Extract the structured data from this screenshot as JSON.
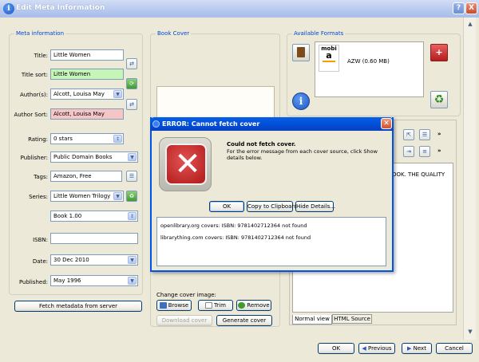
{
  "window": {
    "title": "Edit Meta Information",
    "help_label": "?",
    "close_label": "X"
  },
  "meta": {
    "legend": "Meta information",
    "title_label": "Title:",
    "title_value": "Little Women",
    "title_sort_label": "Title sort:",
    "title_sort_value": "Little Women",
    "authors_label": "Author(s):",
    "authors_value": "Alcott, Louisa May",
    "author_sort_label": "Author Sort:",
    "author_sort_value": "Alcott, Louisa May",
    "rating_label": "Rating:",
    "rating_value": "0 stars",
    "publisher_label": "Publisher:",
    "publisher_value": "Public Domain Books",
    "tags_label": "Tags:",
    "tags_value": "Amazon, Free",
    "series_label": "Series:",
    "series_value": "Little Women Trilogy",
    "series_index_value": "Book 1.00",
    "isbn_label": "ISBN:",
    "isbn_value": "",
    "date_label": "Date:",
    "date_value": "30 Dec 2010",
    "published_label": "Published:",
    "published_value": "May 1996",
    "fetch_label": "Fetch metadata from server"
  },
  "cover": {
    "legend": "Book Cover",
    "change_label": "Change cover image:",
    "browse_label": "Browse",
    "trim_label": "Trim",
    "remove_label": "Remove",
    "download_label": "Download cover",
    "generate_label": "Generate cover"
  },
  "formats": {
    "legend": "Available Formats",
    "format_name": "mobi",
    "format_desc": "AZW (0.60 MB)"
  },
  "comments": {
    "text_fragment": "OOK. THE QUALITY",
    "tab_normal": "Normal view",
    "tab_html": "HTML Source"
  },
  "bottom": {
    "ok_label": "OK",
    "previous_label": "Previous",
    "next_label": "Next",
    "cancel_label": "Cancel"
  },
  "error_dialog": {
    "title": "ERROR: Cannot fetch cover",
    "heading": "Could not fetch cover.",
    "message": "For the error message from each cover source, click Show details below.",
    "ok_label": "OK",
    "copy_label": "Copy to Clipboard",
    "hide_label": "Hide Details...",
    "details": [
      "openlibrary.org covers: ISBN: 9781402712364 not found",
      "librarything.com covers: ISBN: 9781402712364 not found"
    ]
  },
  "colors": {
    "accent": "#0054e3",
    "title_sort_bg": "#c6f5b8",
    "author_sort_bg": "#f6c6c6"
  }
}
